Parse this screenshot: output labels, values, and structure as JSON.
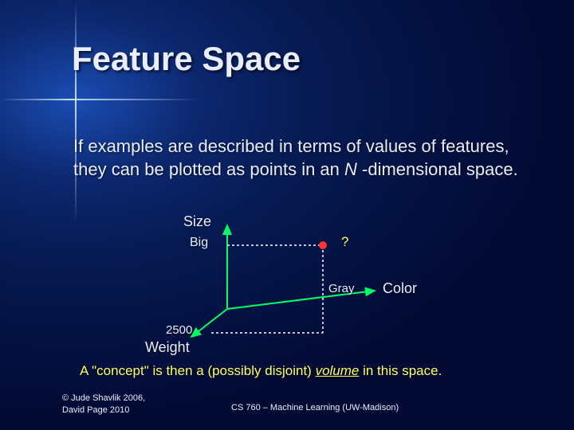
{
  "title": "Feature Space",
  "description_pre": "If examples are described in terms of values of features, they can be plotted as points in an ",
  "description_var": "N",
  "description_post": " -dimensional space.",
  "axes": {
    "y_label": "Size",
    "y_tick": "Big",
    "x_label": "Color",
    "x_tick": "Gray",
    "z_label": "Weight",
    "z_tick": "2500",
    "point_label": "?"
  },
  "bottom_pre": "A \"concept\" is then a (possibly disjoint) ",
  "bottom_vol": "volume",
  "bottom_post": " in this space.",
  "copyright_line1": "© Jude Shavlik 2006,",
  "copyright_line2": "David Page 2010",
  "course": "CS 760 – Machine Learning (UW-Madison)"
}
